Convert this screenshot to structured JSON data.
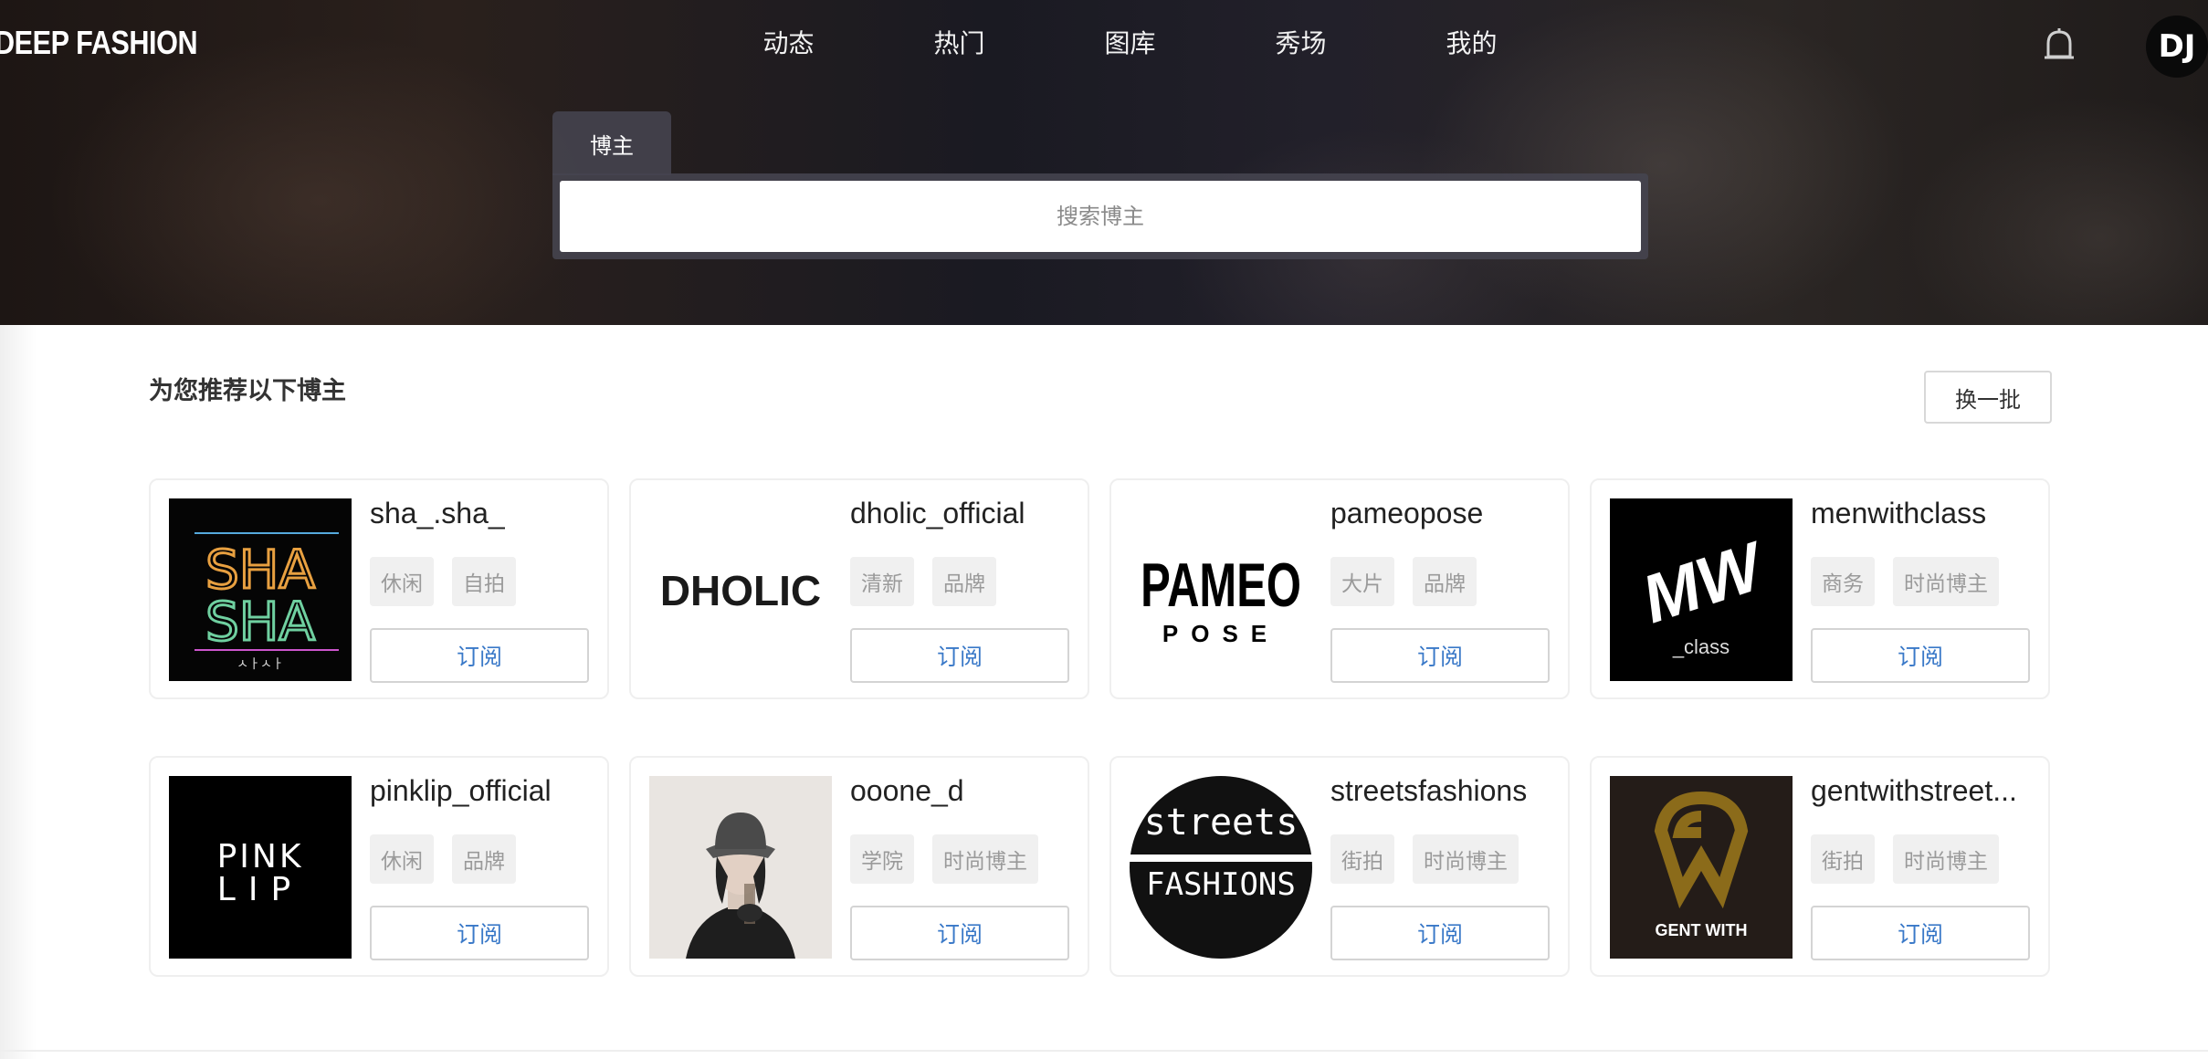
{
  "header": {
    "logo": "DEEP FASHION",
    "nav": [
      "动态",
      "热门",
      "图库",
      "秀场",
      "我的"
    ],
    "avatar_text": "DJ"
  },
  "search": {
    "tab_label": "博主",
    "placeholder": "搜索博主"
  },
  "recommend": {
    "title": "为您推荐以下博主",
    "refresh_label": "换一批",
    "subscribe_label": "订阅",
    "bloggers": [
      {
        "name": "sha_.sha_",
        "tags": [
          "休闲",
          "自拍"
        ]
      },
      {
        "name": "dholic_official",
        "tags": [
          "清新",
          "品牌"
        ]
      },
      {
        "name": "pameopose",
        "tags": [
          "大片",
          "品牌"
        ]
      },
      {
        "name": "menwithclass",
        "tags": [
          "商务",
          "时尚博主"
        ]
      },
      {
        "name": "pinklip_official",
        "tags": [
          "休闲",
          "品牌"
        ]
      },
      {
        "name": "ooone_d",
        "tags": [
          "学院",
          "时尚博主"
        ]
      },
      {
        "name": "streetsfashions",
        "tags": [
          "街拍",
          "时尚博主"
        ]
      },
      {
        "name": "gentwithstreet...",
        "tags": [
          "街拍",
          "时尚博主"
        ]
      }
    ]
  },
  "logos": {
    "sha": "SHA",
    "sha_sub": "ㅅㅏㅅㅏ",
    "dholic": "DHOLIC",
    "pameo_top": "PAMEO",
    "pameo_bottom": "POSE",
    "mw": "MW",
    "mw_sub": "_class",
    "pink_top": "PINK",
    "pink_bottom": "LIP",
    "streets_top": "streets",
    "streets_bottom": "FASHIONS",
    "gent": "GENT WITH"
  }
}
